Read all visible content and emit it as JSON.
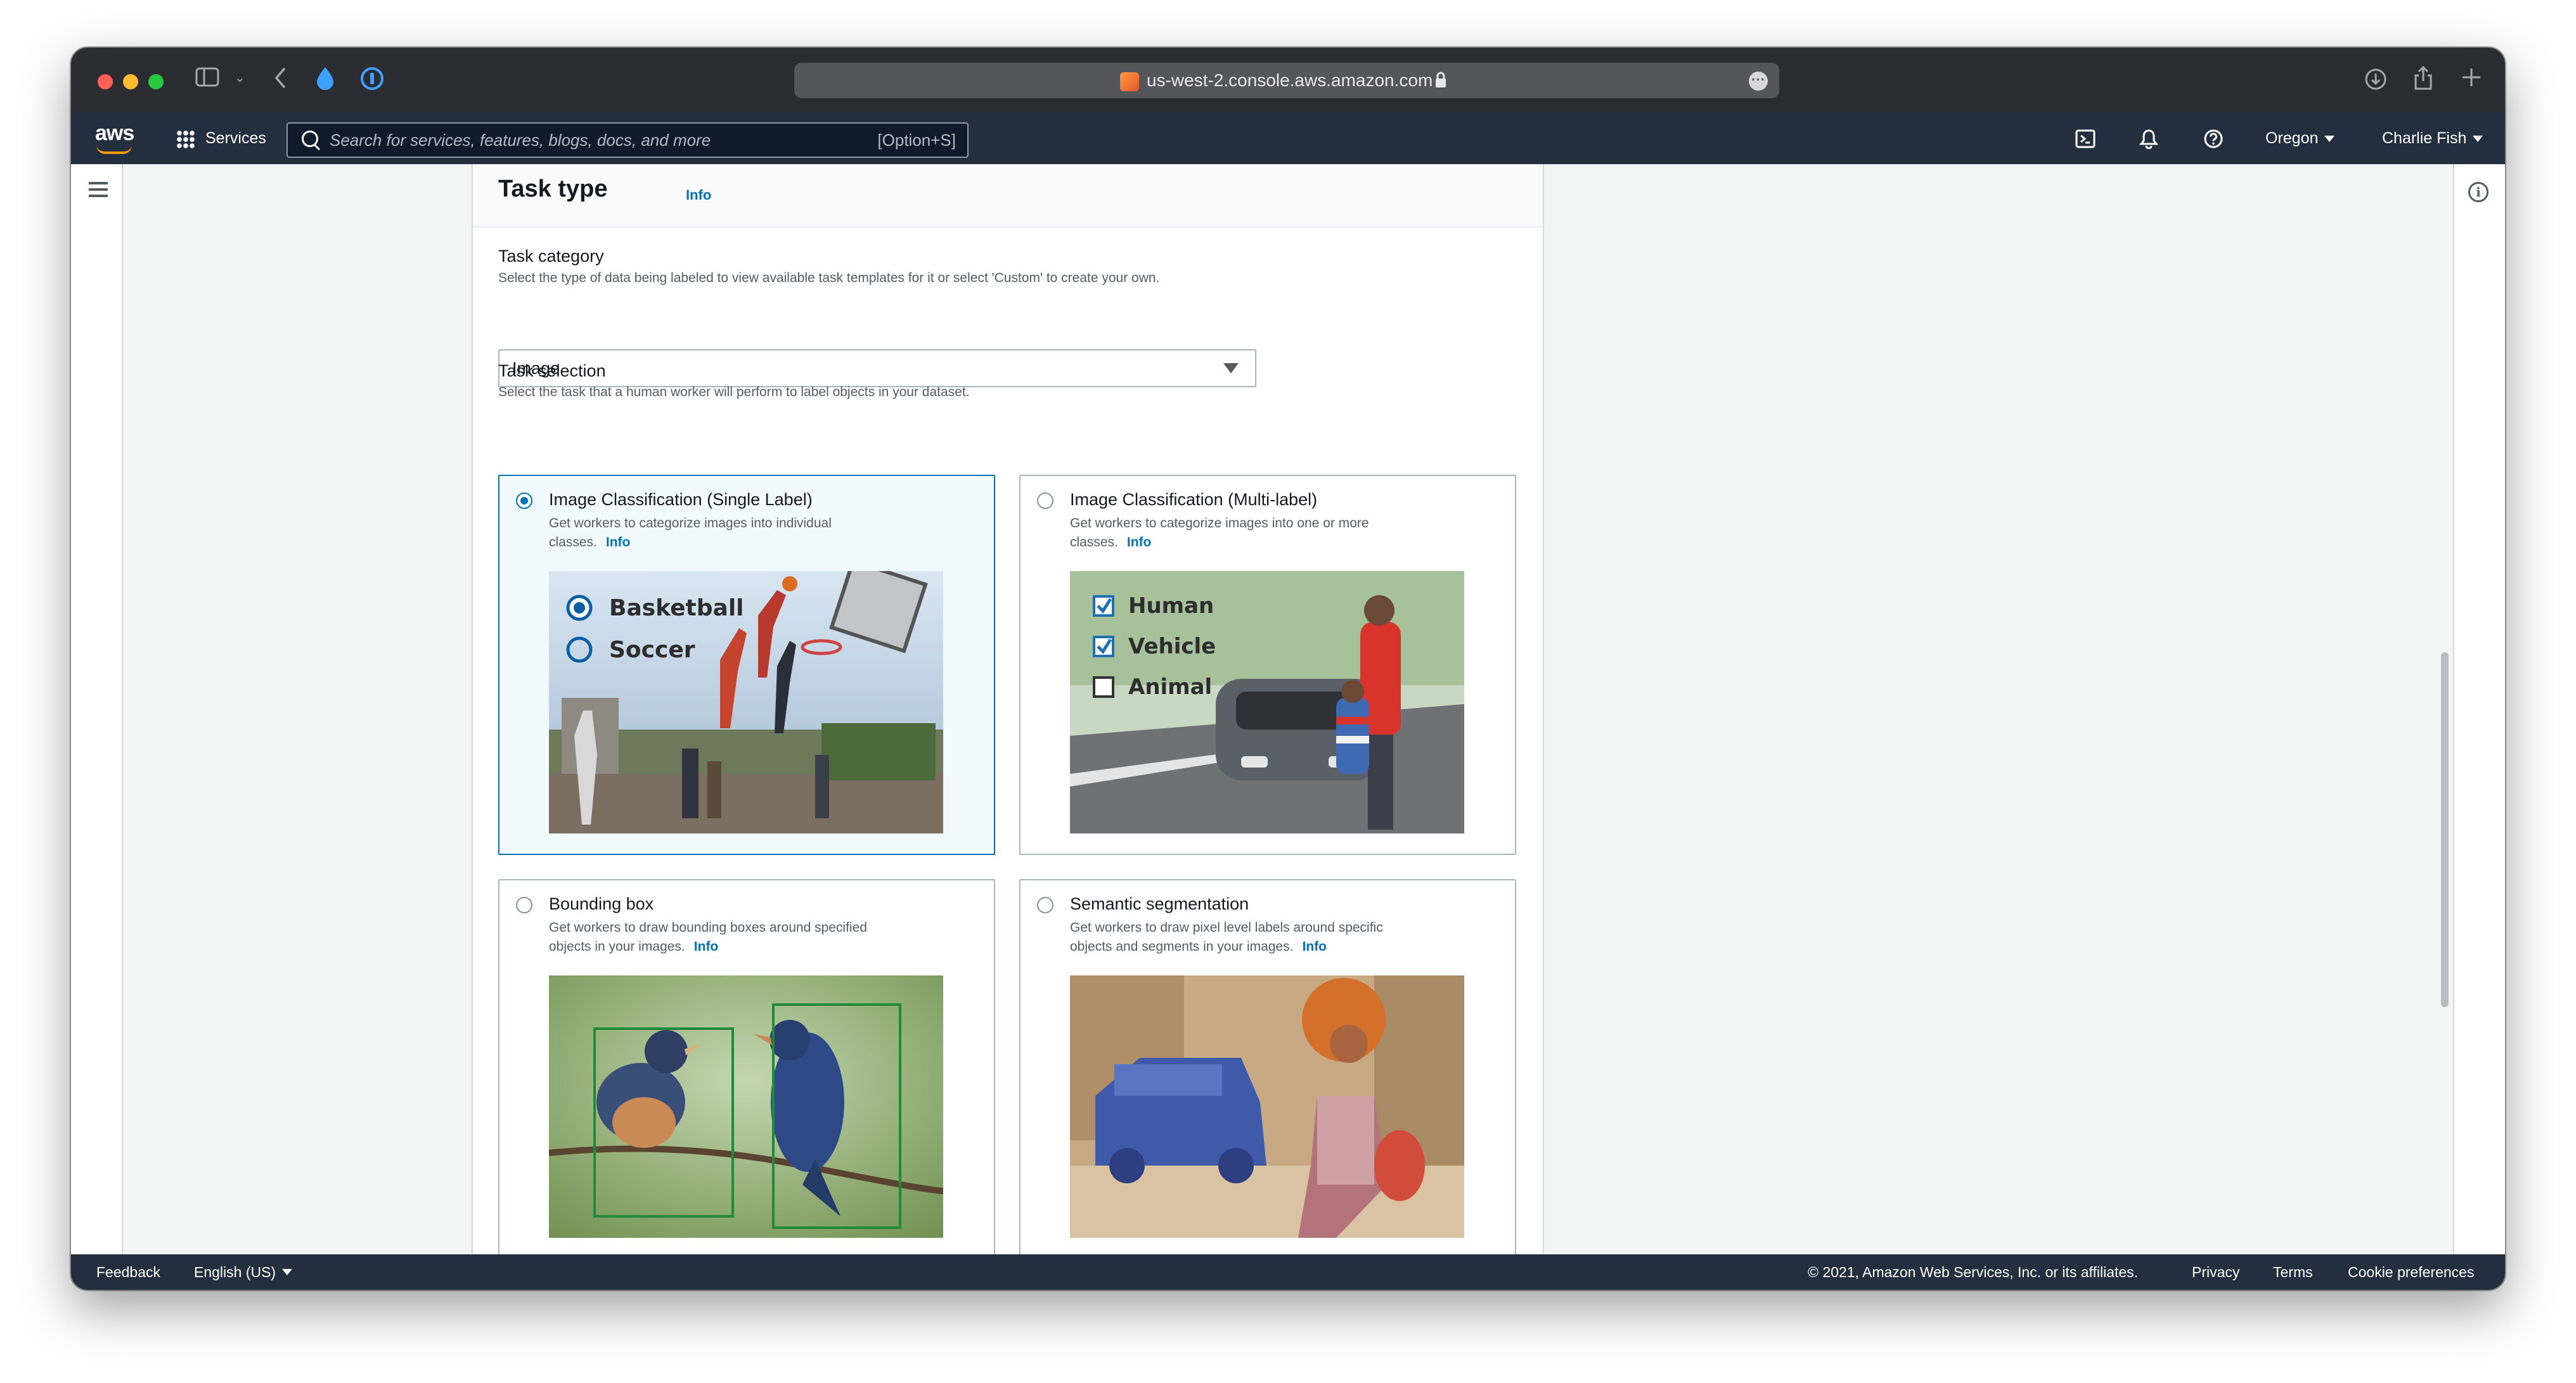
{
  "browser": {
    "url": "us-west-2.console.aws.amazon.com"
  },
  "nav": {
    "logo": "aws",
    "services": "Services",
    "search_placeholder": "Search for services, features, blogs, docs, and more",
    "search_shortcut": "[Option+S]",
    "region": "Oregon",
    "user": "Charlie Fish"
  },
  "panel": {
    "title": "Task type",
    "info": "Info",
    "category_label": "Task category",
    "category_desc": "Select the type of data being labeled to view available task templates for it or select 'Custom' to create your own.",
    "category_value": "Image",
    "selection_label": "Task selection",
    "selection_desc": "Select the task that a human worker will perform to label objects in your dataset."
  },
  "tasks": [
    {
      "title": "Image Classification (Single Label)",
      "desc": "Get workers to categorize images into individual classes.",
      "info": "Info",
      "selected": true,
      "labels": [
        "Basketball",
        "Soccer"
      ]
    },
    {
      "title": "Image Classification (Multi-label)",
      "desc": "Get workers to categorize images into one or more classes.",
      "info": "Info",
      "selected": false,
      "labels": [
        "Human",
        "Vehicle",
        "Animal"
      ]
    },
    {
      "title": "Bounding box",
      "desc": "Get workers to draw bounding boxes around specified objects in your images.",
      "info": "Info",
      "selected": false
    },
    {
      "title": "Semantic segmentation",
      "desc": "Get workers to draw pixel level labels around specific objects and segments in your images.",
      "info": "Info",
      "selected": false
    }
  ],
  "footer": {
    "feedback": "Feedback",
    "language": "English (US)",
    "copyright": "© 2021, Amazon Web Services, Inc. or its affiliates.",
    "privacy": "Privacy",
    "terms": "Terms",
    "cookies": "Cookie preferences"
  },
  "colors": {
    "nav_bg": "#232f3e",
    "accent": "#0073bb",
    "aws_orange": "#ff9900"
  }
}
